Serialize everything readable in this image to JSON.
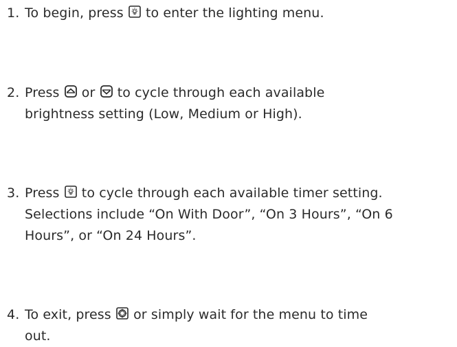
{
  "steps": [
    {
      "number": "1.",
      "before": "To begin, press ",
      "icon": "light-button-icon",
      "after": " to enter the lighting menu."
    },
    {
      "number": "2.",
      "before": "Press ",
      "icon": "up-arrow-button-icon",
      "middle": " or ",
      "icon2": "down-arrow-button-icon",
      "after": " to cycle through each available",
      "line2": "brightness setting (Low, Medium or High)."
    },
    {
      "number": "3.",
      "before": "Press ",
      "icon": "light-button-icon",
      "after": " to cycle through each available timer setting.",
      "line2": "Selections include “On With Door”, “On 3 Hours”, “On 6",
      "line3": "Hours”, or “On 24 Hours”."
    },
    {
      "number": "4.",
      "before": "To exit, press ",
      "icon": "power-button-icon",
      "after": " or simply wait for the menu to time",
      "line2": "out."
    }
  ]
}
